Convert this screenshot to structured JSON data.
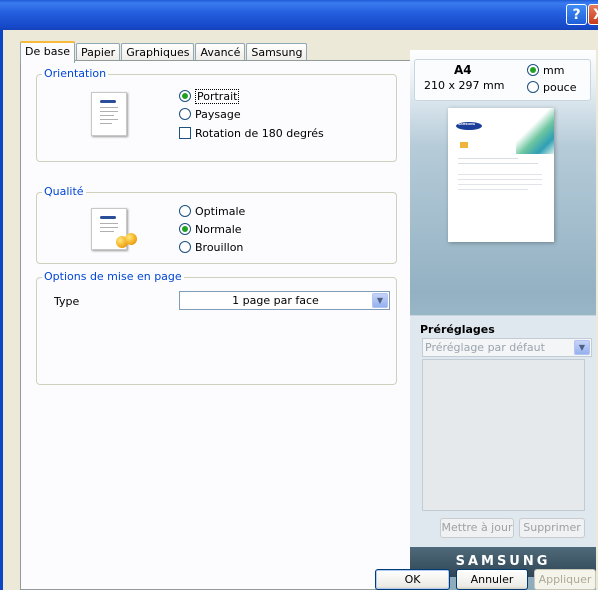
{
  "titlebar": {
    "help_glyph": "?",
    "close_glyph": "X"
  },
  "tabs": [
    {
      "label": "De base",
      "active": true
    },
    {
      "label": "Papier"
    },
    {
      "label": "Graphiques"
    },
    {
      "label": "Avancé"
    },
    {
      "label": "Samsung"
    }
  ],
  "orientation": {
    "title": "Orientation",
    "portrait": "Portrait",
    "paysage": "Paysage",
    "rotation": "Rotation de 180 degrés",
    "selected": "Portrait",
    "rotation_checked": false
  },
  "qualite": {
    "title": "Qualité",
    "optimale": "Optimale",
    "normale": "Normale",
    "brouillon": "Brouillon",
    "selected": "Normale"
  },
  "mise_en_page": {
    "title": "Options de mise en page",
    "type_label": "Type",
    "type_value": "1 page par face"
  },
  "preview": {
    "paper_size": "A4",
    "paper_dims": "210 x 297 mm",
    "unit_mm": "mm",
    "unit_pouce": "pouce",
    "selected_unit": "mm",
    "sheet_logo": "SAMSUNG"
  },
  "presets": {
    "title": "Préréglages",
    "selected": "Préréglage par défaut",
    "update_label": "Mettre à jour",
    "delete_label": "Supprimer"
  },
  "brand": "SAMSUNG",
  "buttons": {
    "ok": "OK",
    "cancel": "Annuler",
    "apply": "Appliquer"
  }
}
